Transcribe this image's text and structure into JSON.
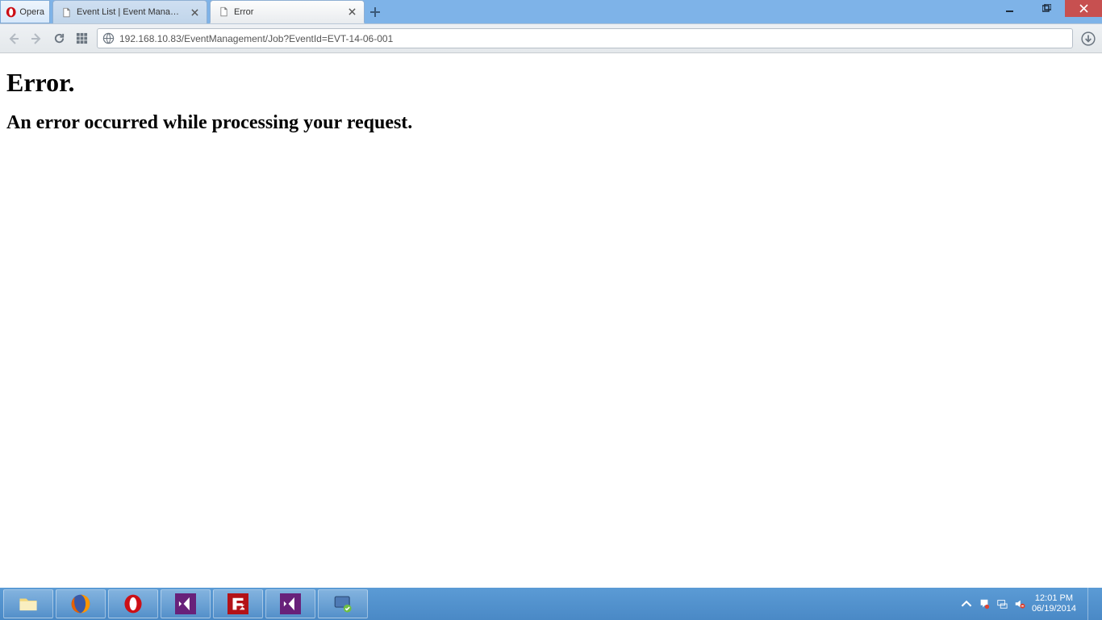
{
  "window": {
    "opera_menu_label": "Opera",
    "tabs": [
      {
        "title": "Event List | Event Management",
        "active": false
      },
      {
        "title": "Error",
        "active": true
      }
    ]
  },
  "address_bar": {
    "url": "192.168.10.83/EventManagement/Job?EventId=EVT-14-06-001"
  },
  "page": {
    "heading": "Error.",
    "subheading": "An error occurred while processing your request."
  },
  "taskbar": {
    "clock_time": "12:01 PM",
    "clock_date": "06/19/2014"
  }
}
